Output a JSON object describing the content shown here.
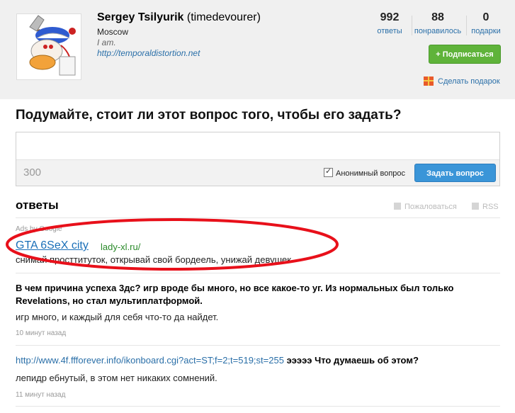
{
  "profile": {
    "name": "Sergey Tsilyurik",
    "username": "(timedevourer)",
    "city": "Moscow",
    "about": "I am.",
    "website": "http://temporaldistortion.net"
  },
  "stats": [
    {
      "value": "992",
      "label": "ответы"
    },
    {
      "value": "88",
      "label": "понравилось"
    },
    {
      "value": "0",
      "label": "подарки"
    }
  ],
  "actions": {
    "subscribe": "+ Подписаться",
    "gift": "Сделать подарок"
  },
  "ask": {
    "title": "Подумайте, стоит ли этот вопрос того, чтобы его задать?",
    "counter": "300",
    "anonymous_label": "Анонимный вопрос",
    "anonymous_checked": true,
    "submit": "Задать вопрос"
  },
  "answers": {
    "title": "ответы",
    "report": "Пожаловаться",
    "rss": "RSS"
  },
  "ad": {
    "label": "Ads by Google",
    "link": "GTA 6SeX city",
    "domain": "lady-xl.ru/",
    "text": "снимай просттитуток, открывай свой бордеель, унижай девушек"
  },
  "qa": [
    {
      "question": "В чем причина успеха 3дс? игр вроде бы много, но все какое-то уг. Из нормальных был только Revelations, но стал мультиплатформой.",
      "answer": "игр много, и каждый для себя что-то да найдет.",
      "time": "10 минут назад"
    },
    {
      "question_link": "http://www.4f.ffforever.info/ikonboard.cgi?act=ST;f=2;t=519;st=255",
      "question": "эээээ Что думаешь об этом?",
      "answer": "лепидр ебнутый, в этом нет никаких сомнений.",
      "time": "11 минут назад"
    }
  ],
  "colors": {
    "link": "#2a6fa8",
    "subscribe_green": "#5fb33a",
    "ask_blue": "#3a95d8",
    "highlight_ellipse": "#e8101a"
  }
}
